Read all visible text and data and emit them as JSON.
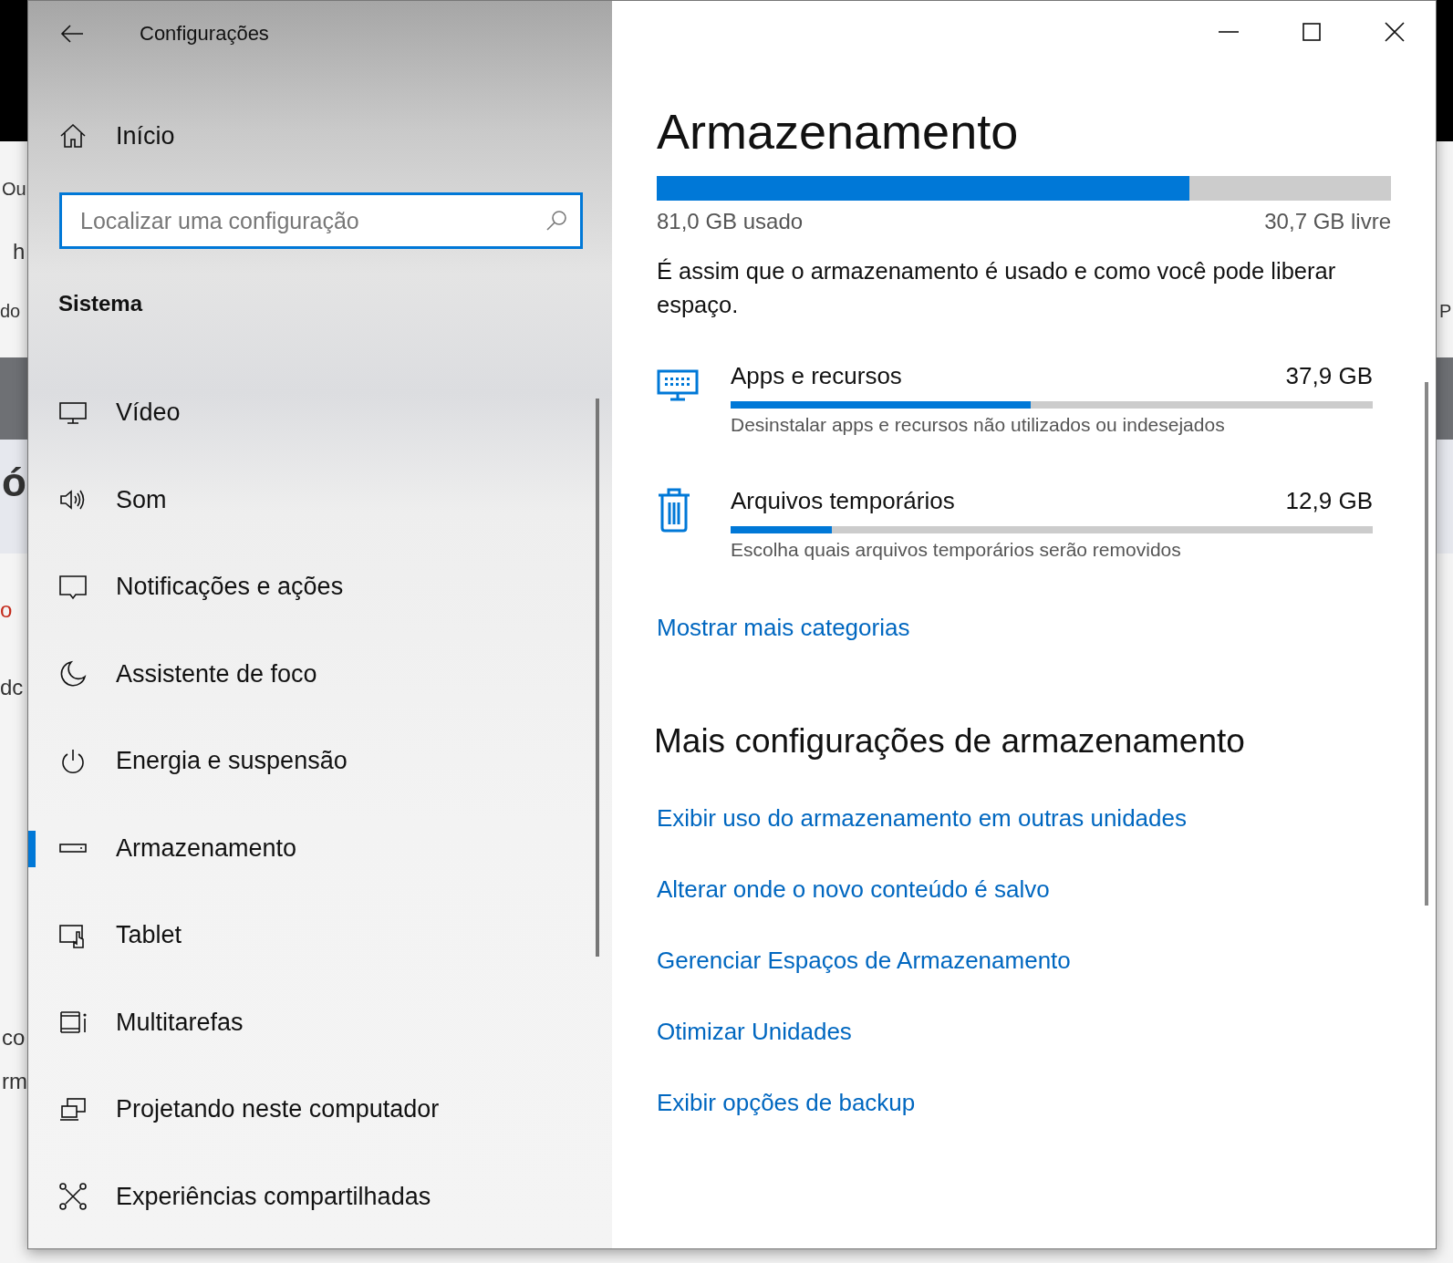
{
  "background_fragments": [
    {
      "text": "Ou",
      "kind": "plain"
    },
    {
      "text": "h",
      "kind": "large"
    },
    {
      "text": "do",
      "kind": "plain"
    },
    {
      "text": "ó",
      "kind": "heading"
    },
    {
      "text": "o",
      "kind": "alert"
    },
    {
      "text": "dc",
      "kind": "large"
    },
    {
      "text": "co",
      "kind": "large"
    },
    {
      "text": "rm",
      "kind": "large"
    },
    {
      "text": "P",
      "kind": "plain"
    }
  ],
  "window": {
    "title": "Configurações"
  },
  "sidebar": {
    "home": "Início",
    "search": {
      "placeholder": "Localizar uma configuração"
    },
    "section": "Sistema",
    "items": [
      {
        "label": "Vídeo",
        "selected": false
      },
      {
        "label": "Som",
        "selected": false
      },
      {
        "label": "Notificações e ações",
        "selected": false
      },
      {
        "label": "Assistente de foco",
        "selected": false
      },
      {
        "label": "Energia e suspensão",
        "selected": false
      },
      {
        "label": "Armazenamento",
        "selected": true
      },
      {
        "label": "Tablet",
        "selected": false
      },
      {
        "label": "Multitarefas",
        "selected": false
      },
      {
        "label": "Projetando neste computador",
        "selected": false
      },
      {
        "label": "Experiências compartilhadas",
        "selected": false
      }
    ]
  },
  "content": {
    "title": "Armazenamento",
    "usage": {
      "level": 0.725,
      "used": "81,0 GB usado",
      "free": "30,7 GB livre"
    },
    "description": "É assim que o armazenamento é usado e como você pode liberar espaço.",
    "categories": [
      {
        "name": "Apps e recursos",
        "size": "37,9 GB",
        "level": 0.468,
        "hint": "Desinstalar apps e recursos não utilizados ou indesejados"
      },
      {
        "name": "Arquivos temporários",
        "size": "12,9 GB",
        "level": 0.158,
        "hint": "Escolha quais arquivos temporários serão removidos"
      }
    ],
    "more_link": "Mostrar mais categorias",
    "more_heading": "Mais configurações de armazenamento",
    "links": [
      "Exibir uso do armazenamento em outras unidades",
      "Alterar onde o novo conteúdo é salvo",
      "Gerenciar Espaços de Armazenamento",
      "Otimizar Unidades",
      "Exibir opções de backup"
    ]
  }
}
